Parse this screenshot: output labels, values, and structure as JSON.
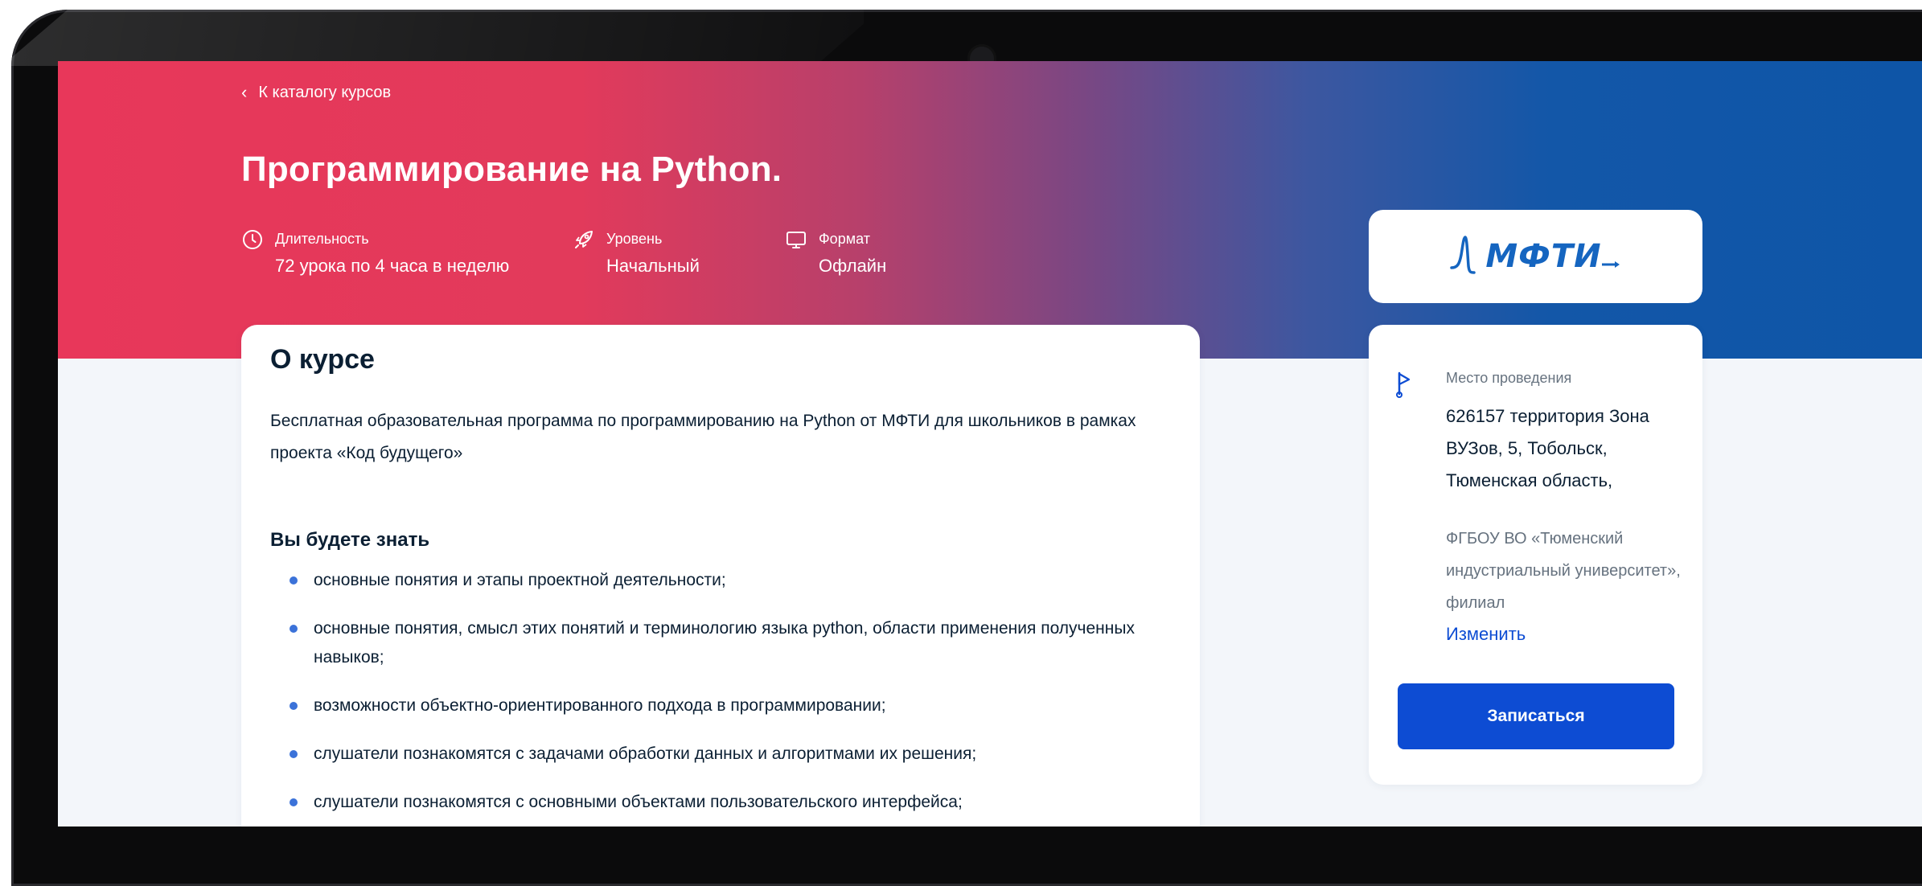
{
  "nav": {
    "back_label": "К каталогу курсов"
  },
  "course": {
    "title": "Программирование на Python.",
    "meta": [
      {
        "icon": "clock-icon",
        "label": "Длительность",
        "value": "72 урока по 4 часа в неделю"
      },
      {
        "icon": "rocket-icon",
        "label": "Уровень",
        "value": "Начальный"
      },
      {
        "icon": "monitor-icon",
        "label": "Формат",
        "value": "Офлайн"
      }
    ]
  },
  "provider": {
    "logo_text": "МФТИ",
    "logo_color": "#1565c0"
  },
  "about": {
    "heading": "О курсе",
    "description": "Бесплатная образовательная программа по программированию на Python от МФТИ для школьников в рамках проекта «Код будущего»",
    "skills_heading": "Вы будете знать",
    "skills": [
      "основные понятия и этапы проектной деятельности;",
      "основные понятия, смысл этих понятий и терминологию языка python, области применения полученных навыков;",
      "возможности объектно-ориентированного подхода в программировании;",
      "слушатели познакомятся с задачами обработки данных и алгоритмами их решения;",
      "слушатели познакомятся с основными объектами пользовательского интерфейса;"
    ]
  },
  "venue": {
    "label": "Место проведения",
    "address": "626157 территория Зона ВУЗов, 5, Тобольск, Тюменская область,",
    "organization": "ФГБОУ ВО «Тюменский индустриальный университет», филиал",
    "change_label": "Изменить",
    "enroll_label": "Записаться"
  },
  "colors": {
    "hero_start": "#e8375a",
    "hero_end": "#0e55a7",
    "primary": "#0d4cd3",
    "bullet": "#3b72d9"
  }
}
